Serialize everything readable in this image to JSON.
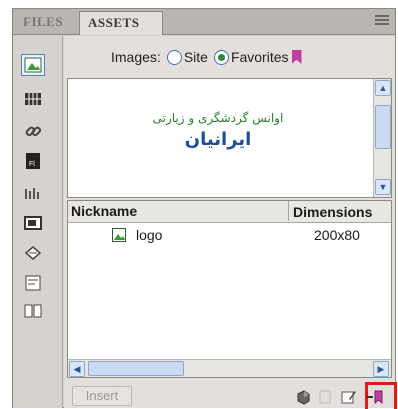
{
  "tabs": {
    "files": "FILES",
    "assets": "ASSETS"
  },
  "images_filter": {
    "label": "Images:",
    "option_site": "Site",
    "option_favorites": "Favorites",
    "selected": "Favorites"
  },
  "preview": {
    "logo_line1": "اوانس گردشگری و زیارتی",
    "logo_line2": "ایرانیان"
  },
  "list": {
    "col_nickname": "Nickname",
    "col_dimensions": "Dimensions",
    "rows": [
      {
        "name": "logo",
        "dimensions": "200x80"
      }
    ]
  },
  "footer": {
    "insert_label": "Insert"
  },
  "colors": {
    "highlight": "#e01b1b",
    "radio_selected": "#2c8a3a",
    "favorites_accent": "#c43ea2"
  }
}
